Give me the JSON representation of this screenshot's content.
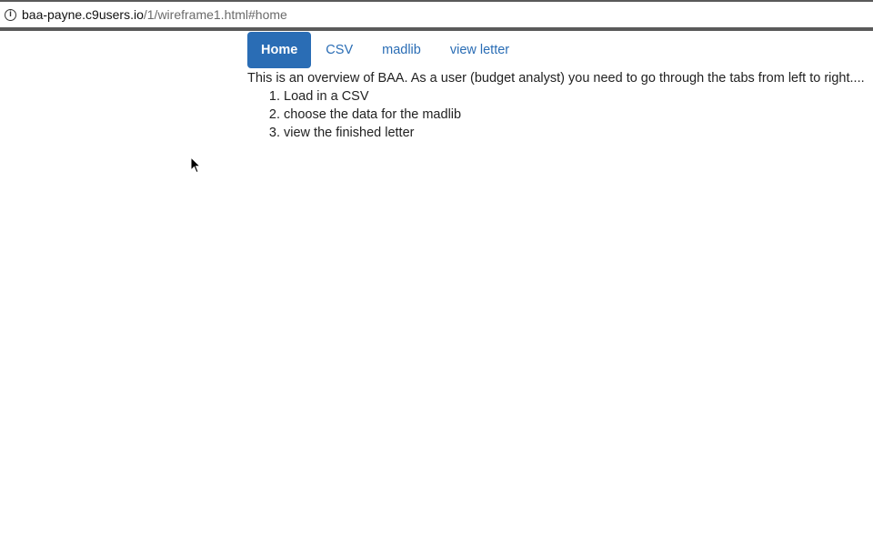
{
  "browser": {
    "url_host": "baa-payne.c9users.io",
    "url_path": "/1/wireframe1.html#home"
  },
  "nav": {
    "tabs": [
      {
        "label": "Home",
        "active": true
      },
      {
        "label": "CSV",
        "active": false
      },
      {
        "label": "madlib",
        "active": false
      },
      {
        "label": "view letter",
        "active": false
      }
    ]
  },
  "main": {
    "overview_text": "This is an overview of BAA. As a user (budget analyst) you need to go through the tabs from left to right....",
    "steps": [
      "Load in a CSV",
      "choose the data for the madlib",
      "view the finished letter"
    ]
  },
  "colors": {
    "accent": "#2a6db5",
    "text": "#222222"
  },
  "icons": {
    "info": "info-icon",
    "cursor": "mouse-pointer-icon"
  }
}
